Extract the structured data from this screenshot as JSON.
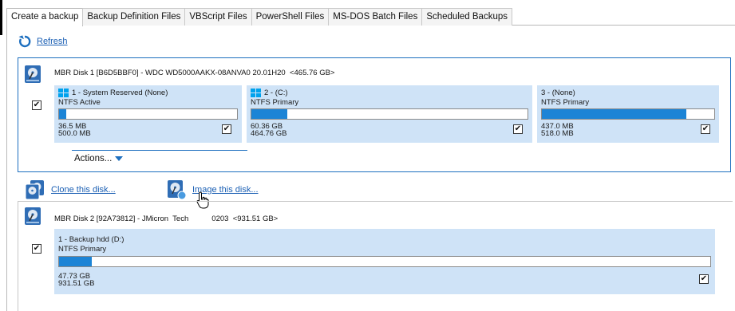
{
  "tabs": [
    {
      "label": "Create a backup",
      "active": true
    },
    {
      "label": "Backup Definition Files",
      "active": false
    },
    {
      "label": "VBScript Files",
      "active": false
    },
    {
      "label": "PowerShell Files",
      "active": false
    },
    {
      "label": "MS-DOS Batch Files",
      "active": false
    },
    {
      "label": "Scheduled Backups",
      "active": false
    }
  ],
  "toolbar": {
    "refresh_label": "Refresh",
    "refresh_icon": "refresh-icon"
  },
  "colors": {
    "accent": "#1d6fbf",
    "partition_bg": "#cfe3f7",
    "bar_fill": "#1c84d6",
    "link": "#1a5fb4"
  },
  "disks": [
    {
      "title": "MBR Disk 1 [B6D5BBF0] - WDC WD5000AAKX-08ANVA0 20.01H20  <465.76 GB>",
      "checked": true,
      "actions_label": "Actions...",
      "partitions": [
        {
          "label": "1 - System Reserved (None)",
          "type": "NTFS Active",
          "used": "36.5 MB",
          "total": "500.0 MB",
          "fill_fraction": 0.04,
          "windows_logo": true,
          "checked": true
        },
        {
          "label": "2 - (C:)",
          "type": "NTFS Primary",
          "used": "60.36 GB",
          "total": "464.76 GB",
          "fill_fraction": 0.13,
          "windows_logo": true,
          "checked": true
        },
        {
          "label": "3 - (None)",
          "type": "NTFS Primary",
          "used": "437.0 MB",
          "total": "518.0 MB",
          "fill_fraction": 0.84,
          "windows_logo": false,
          "checked": true
        }
      ]
    },
    {
      "title": "MBR Disk 2 [92A73812] - JMicron  Tech           0203  <931.51 GB>",
      "checked": true,
      "partitions": [
        {
          "label": "1 - Backup hdd (D:)",
          "type": "NTFS Primary",
          "used": "47.73 GB",
          "total": "931.51 GB",
          "fill_fraction": 0.05,
          "windows_logo": false,
          "checked": true
        }
      ]
    }
  ],
  "tasks": {
    "clone_label": "Clone this disk...",
    "image_label": "Image this disk..."
  },
  "check_glyph": "✔"
}
